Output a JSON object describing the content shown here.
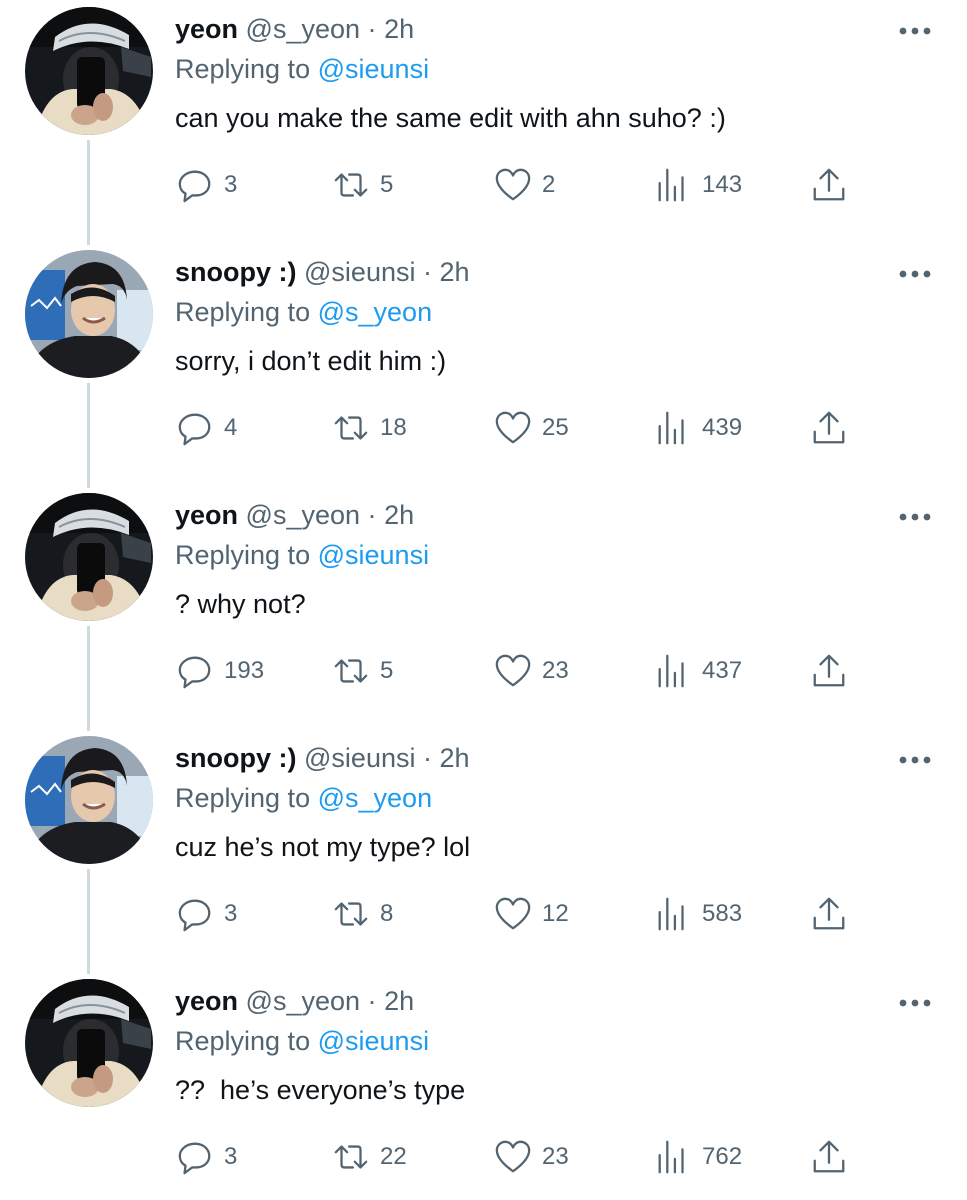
{
  "colors": {
    "text": "#0f1419",
    "secondary": "#536471",
    "accent": "#1d9bf0",
    "thread_line": "#cfd9de"
  },
  "tweets": [
    {
      "name": "yeon",
      "handle": "@s_yeon",
      "dot": "·",
      "time": "2h",
      "replying_label": "Replying to",
      "replying_to": "@sieunsi",
      "text": "can you make the same edit with ahn suho? :)",
      "replies": "3",
      "retweets": "5",
      "likes": "2",
      "views": "143"
    },
    {
      "name": "snoopy :)",
      "handle": "@sieunsi",
      "dot": "·",
      "time": "2h",
      "replying_label": "Replying to",
      "replying_to": "@s_yeon",
      "text": "sorry, i don’t edit him :)",
      "replies": "4",
      "retweets": "18",
      "likes": "25",
      "views": "439"
    },
    {
      "name": "yeon",
      "handle": "@s_yeon",
      "dot": "·",
      "time": "2h",
      "replying_label": "Replying to",
      "replying_to": "@sieunsi",
      "text": "? why not?",
      "replies": "193",
      "retweets": "5",
      "likes": "23",
      "views": "437"
    },
    {
      "name": "snoopy :)",
      "handle": "@sieunsi",
      "dot": "·",
      "time": "2h",
      "replying_label": "Replying to",
      "replying_to": "@s_yeon",
      "text": "cuz he’s not my type? lol",
      "replies": "3",
      "retweets": "8",
      "likes": "12",
      "views": "583"
    },
    {
      "name": "yeon",
      "handle": "@s_yeon",
      "dot": "·",
      "time": "2h",
      "replying_label": "Replying to",
      "replying_to": "@sieunsi",
      "text": "??  he’s everyone’s type",
      "replies": "3",
      "retweets": "22",
      "likes": "23",
      "views": "762"
    }
  ]
}
